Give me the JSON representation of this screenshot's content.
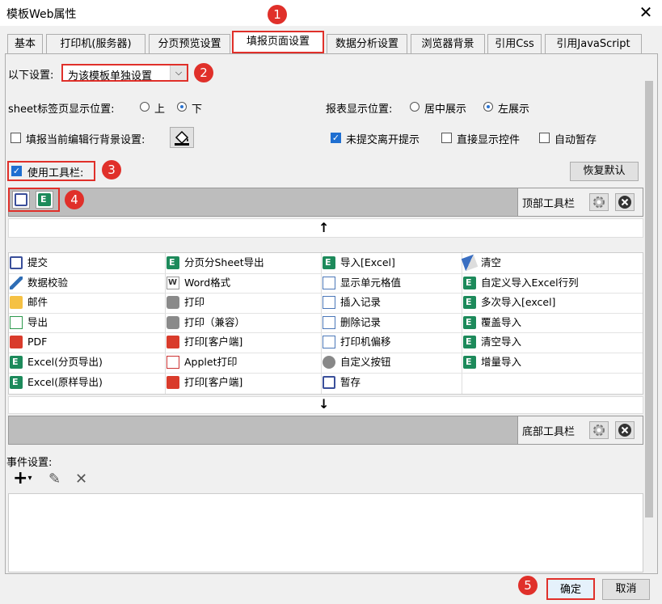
{
  "window": {
    "title": "模板Web属性",
    "close_label": "✕"
  },
  "tabs": [
    {
      "label": "基本"
    },
    {
      "label": "打印机(服务器)"
    },
    {
      "label": "分页预览设置"
    },
    {
      "label": "填报页面设置"
    },
    {
      "label": "数据分析设置"
    },
    {
      "label": "浏览器背景"
    },
    {
      "label": "引用Css"
    },
    {
      "label": "引用JavaScript"
    }
  ],
  "badges": [
    "1",
    "2",
    "3",
    "4",
    "5"
  ],
  "settings": {
    "label": "以下设置:",
    "value": "为该模板单独设置",
    "arrow": "⌵"
  },
  "sheet_position": {
    "label": "sheet标签页显示位置:",
    "options": [
      "上",
      "下"
    ],
    "selected": "下"
  },
  "report_position": {
    "label": "报表显示位置:",
    "options": [
      "居中展示",
      "左展示"
    ],
    "selected": "左展示"
  },
  "checkboxes": {
    "edit_row_bg": {
      "label": "填报当前编辑行背景设置:",
      "checked": false
    },
    "unsubmitted_prompt": {
      "label": "未提交离开提示",
      "checked": true
    },
    "direct_show": {
      "label": "直接显示控件",
      "checked": false
    },
    "auto_save": {
      "label": "自动暂存",
      "checked": false
    },
    "use_toolbar": {
      "label": "使用工具栏:",
      "checked": true
    }
  },
  "restore_default": "恢复默认",
  "top_toolbar_label": "顶部工具栏",
  "bottom_toolbar_label": "底部工具栏",
  "arrow_up": "↑",
  "arrow_down": "↓",
  "toolbar_items": [
    [
      {
        "icon": "save-icon",
        "label": "提交"
      },
      {
        "icon": "excel-icon",
        "label": "分页分Sheet导出"
      },
      {
        "icon": "excel-icon",
        "label": "导入[Excel]"
      },
      {
        "icon": "eraser-icon",
        "label": "清空"
      }
    ],
    [
      {
        "icon": "pencil-icon",
        "label": "数据校验"
      },
      {
        "icon": "word-icon",
        "label": "Word格式"
      },
      {
        "icon": "grid-icon",
        "label": "显示单元格值"
      },
      {
        "icon": "excel-icon",
        "label": "自定义导入Excel行列"
      }
    ],
    [
      {
        "icon": "mail-icon",
        "label": "邮件"
      },
      {
        "icon": "print-icon",
        "label": "打印"
      },
      {
        "icon": "insert-row-icon",
        "label": "插入记录"
      },
      {
        "icon": "excel-icon",
        "label": "多次导入[excel]"
      }
    ],
    [
      {
        "icon": "export-icon",
        "label": "导出"
      },
      {
        "icon": "print-icon",
        "label": "打印（兼容）"
      },
      {
        "icon": "delete-row-icon",
        "label": "删除记录"
      },
      {
        "icon": "excel-icon",
        "label": "覆盖导入"
      }
    ],
    [
      {
        "icon": "pdf-icon",
        "label": "PDF"
      },
      {
        "icon": "fl-print-icon",
        "label": "打印[客户端]"
      },
      {
        "icon": "move-icon",
        "label": "打印机偏移"
      },
      {
        "icon": "excel-icon",
        "label": "清空导入"
      }
    ],
    [
      {
        "icon": "excel-icon",
        "label": "Excel(分页导出)"
      },
      {
        "icon": "java-icon",
        "label": "Applet打印"
      },
      {
        "icon": "gear-icon",
        "label": "自定义按钮"
      },
      {
        "icon": "excel-icon",
        "label": "增量导入"
      }
    ],
    [
      {
        "icon": "excel-icon",
        "label": "Excel(原样导出)"
      },
      {
        "icon": "pdf-icon",
        "label": "打印[客户端]"
      },
      {
        "icon": "save-icon",
        "label": "暂存"
      },
      {
        "icon": "",
        "label": ""
      }
    ]
  ],
  "events": {
    "label": "事件设置:",
    "add": "+",
    "add_caret": "▾",
    "edit": "✎",
    "delete": "✕"
  },
  "footer": {
    "ok": "确定",
    "cancel": "取消"
  },
  "colors": {
    "highlight": "#e0302a",
    "accent": "#1f6fd1"
  }
}
